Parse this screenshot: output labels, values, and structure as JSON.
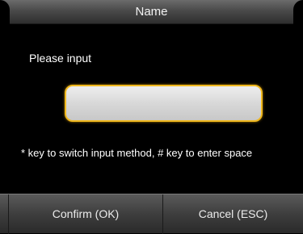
{
  "dialog": {
    "title": "Name",
    "prompt": "Please input",
    "input_value": "",
    "hint": "* key to switch input method, # key to enter space"
  },
  "footer": {
    "confirm_label": "Confirm (OK)",
    "cancel_label": "Cancel (ESC)"
  },
  "colors": {
    "background": "#000000",
    "input_border": "#f0b81e",
    "text": "#ffffff"
  }
}
